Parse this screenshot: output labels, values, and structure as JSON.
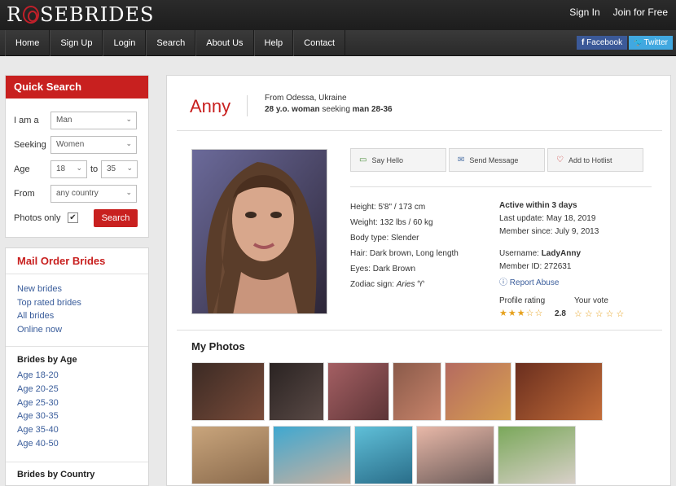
{
  "header": {
    "logo_text": "RSEBRIDES",
    "links": [
      "Sign In",
      "Join for Free"
    ],
    "nav": [
      "Home",
      "Sign Up",
      "Login",
      "Search",
      "About Us",
      "Help",
      "Contact"
    ],
    "social": [
      "Facebook",
      "Twitter"
    ]
  },
  "quick_search": {
    "title": "Quick Search",
    "i_am_label": "I am a",
    "i_am_value": "Man",
    "seeking_label": "Seeking",
    "seeking_value": "Women",
    "age_label": "Age",
    "age_from": "18",
    "age_to_label": "to",
    "age_to": "35",
    "from_label": "From",
    "from_value": "any country",
    "photos_only_label": "Photos only",
    "photos_only_checked": true,
    "search_button": "Search"
  },
  "mail_order": {
    "title": "Mail Order Brides",
    "links": [
      "New brides",
      "Top rated brides",
      "All brides",
      "Online now"
    ],
    "by_age_title": "Brides by Age",
    "age_links": [
      "Age 18-20",
      "Age 20-25",
      "Age 25-30",
      "Age 30-35",
      "Age 35-40",
      "Age 40-50"
    ],
    "by_country_title": "Brides by Country"
  },
  "profile": {
    "name": "Anny",
    "from": "From Odessa, Ukraine",
    "seeking_prefix": "28 y.o. woman",
    "seeking_middle": "seeking",
    "seeking_suffix": "man 28-36",
    "actions": [
      "Say Hello",
      "Send Message",
      "Add to Hotlist"
    ],
    "height": "Height: 5'8\" / 173 cm",
    "weight": "Weight: 132 lbs / 60 kg",
    "body": "Body type: Slender",
    "hair": "Hair: Dark brown, Long length",
    "eyes": "Eyes: Dark Brown",
    "zodiac_label": "Zodiac sign:",
    "zodiac_value": "Aries",
    "active": "Active within 3 days",
    "last_update": "Last update: May 18, 2019",
    "member_since": "Member since: July 9, 2013",
    "username_label": "Username:",
    "username": "LadyAnny",
    "member_id": "Member ID: 272631",
    "report": "Report Abuse",
    "rating_label": "Profile rating",
    "rating_value": "2.8",
    "rating": 2.8,
    "vote_label": "Your vote",
    "photos_title": "My Photos"
  },
  "colors": {
    "brand_red": "#c8201f",
    "link_blue": "#3a5d9b",
    "star": "#e6a11d"
  }
}
